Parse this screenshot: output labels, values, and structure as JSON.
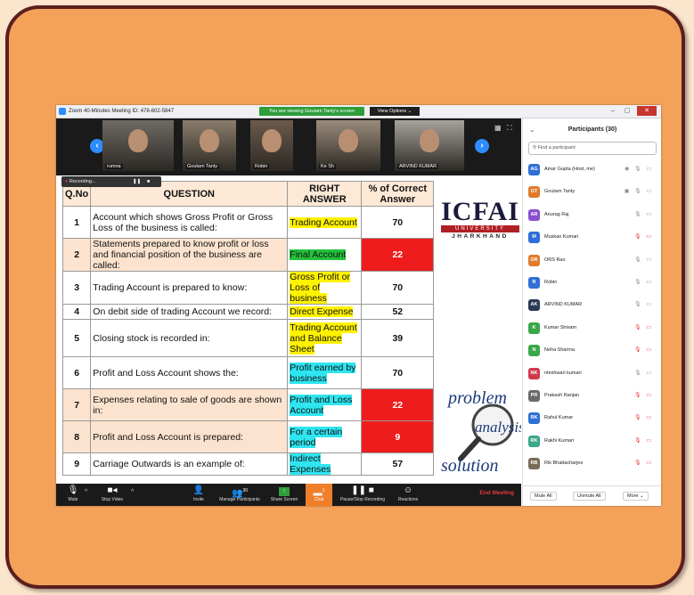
{
  "window": {
    "title": "Zoom 40-Minutes Meeting ID: 478-602-5847",
    "viewing": "You are viewing Goutam Tanty's screen",
    "view_options": "View Options ⌄"
  },
  "video_strip": {
    "tiles": [
      {
        "name": "rumna",
        "color": "#6f6a64"
      },
      {
        "name": "Goutam Tanty",
        "color": "#8a7d6c"
      },
      {
        "name": "Robin",
        "color": "#6b5a4c"
      },
      {
        "name": "Ke Sh",
        "color": "#9b8c7c"
      },
      {
        "name": "ARVIND KUMAR",
        "color": "#a6a39b"
      }
    ]
  },
  "recording": {
    "label": "Recording..."
  },
  "table": {
    "headers": {
      "no": "Q.No",
      "question": "QUESTION",
      "answer": "RIGHT ANSWER",
      "percent": "% of Correct Answer"
    },
    "rows": [
      {
        "no": "1",
        "question": "Account which shows Gross Profit or Gross Loss of the business is called:",
        "answer": "Trading Account",
        "hl": "hy",
        "percent": "70",
        "red": false,
        "shade": false
      },
      {
        "no": "2",
        "question": "Statements prepared to know profit or loss and financial position of the business are called:",
        "answer": "Final Account",
        "hl": "hg",
        "percent": "22",
        "red": true,
        "shade": true
      },
      {
        "no": "3",
        "question": "Trading Account is prepared to know:",
        "answer": "Gross Profit or Loss of business",
        "hl": "hy",
        "percent": "70",
        "red": false,
        "shade": false
      },
      {
        "no": "4",
        "question": "On debit side of trading Account we record:",
        "answer": "Direct Expense",
        "hl": "hy",
        "percent": "52",
        "red": false,
        "shade": false
      },
      {
        "no": "5",
        "question": "Closing stock is recorded in:",
        "answer": "Trading Account and Balance Sheet",
        "hl": "hy",
        "percent": "39",
        "red": false,
        "shade": false
      },
      {
        "no": "6",
        "question": "Profit and Loss Account shows the:",
        "answer": "Profit earned by business",
        "hl": "hc",
        "percent": "70",
        "red": false,
        "shade": false
      },
      {
        "no": "7",
        "question": "Expenses relating to sale of goods are shown in:",
        "answer": "Profit and Loss Account",
        "hl": "hc",
        "percent": "22",
        "red": true,
        "shade": true
      },
      {
        "no": "8",
        "question": "Profit and Loss Account is prepared:",
        "answer": "For a certain period",
        "hl": "hc",
        "percent": "9",
        "red": true,
        "shade": true
      },
      {
        "no": "9",
        "question": "Carriage Outwards is an example of:",
        "answer": "Indirect Expenses",
        "hl": "hc",
        "percent": "57",
        "red": false,
        "shade": false
      }
    ]
  },
  "logo": {
    "name": "ICFAI",
    "sub": "UNIVERSITY",
    "region": "JHARKHAND"
  },
  "graphic": {
    "word1": "problem",
    "word2": "analysis",
    "word3": "solution"
  },
  "toolbar": {
    "mute": "Mute",
    "stop_video": "Stop Video",
    "invite": "Invite",
    "manage": "Manage Participants",
    "participant_count": "30",
    "share": "Share Screen",
    "chat": "Chat",
    "chat_badge": "1",
    "record": "Pause/Stop Recording",
    "reactions": "Reactions",
    "end": "End Meeting"
  },
  "panel": {
    "title": "Participants (30)",
    "search_placeholder": "Find a participant",
    "participants": [
      {
        "initials": "AG",
        "color": "#2f6fd6",
        "name": "Amar Gupta (Host, me)",
        "icons": "◉ 🎙 ▭",
        "muted": false
      },
      {
        "initials": "GT",
        "color": "#e07a2c",
        "name": "Goutam Tanty",
        "icons": "▣ 🎙 ▭",
        "muted": false
      },
      {
        "initials": "AR",
        "color": "#8a4fd0",
        "name": "Anurag Raj",
        "icons": "🎙 ▭",
        "muted": false
      },
      {
        "initials": "M",
        "color": "#2f6fd6",
        "name": "Muskan Kumari",
        "icons": "🎙 ▭",
        "muted": true
      },
      {
        "initials": "OR",
        "color": "#e07a2c",
        "name": "ORS Rao",
        "icons": "🎙 ▭",
        "muted": false
      },
      {
        "initials": "R",
        "color": "#2f6fd6",
        "name": "Robin",
        "icons": "🎙 ▭",
        "muted": false
      },
      {
        "initials": "AK",
        "color": "#2b3a55",
        "name": "ARVIND KUMAR",
        "icons": "🎙 ▭",
        "muted": false
      },
      {
        "initials": "K",
        "color": "#3aa84b",
        "name": "Kumar Shivam",
        "icons": "🎙 ▭",
        "muted": true
      },
      {
        "initials": "N",
        "color": "#3aa84b",
        "name": "Neha Sharma",
        "icons": "🎙 ▭",
        "muted": true
      },
      {
        "initials": "NK",
        "color": "#d0394a",
        "name": "nteshwari kumari",
        "icons": "🎙 ▭",
        "muted": false
      },
      {
        "initials": "PR",
        "color": "#6a6a6a",
        "name": "Prakash Ranjan",
        "icons": "🎙 ▭",
        "muted": true
      },
      {
        "initials": "RK",
        "color": "#2f6fd6",
        "name": "Rahul Kumar",
        "icons": "🎙 ▭",
        "muted": true
      },
      {
        "initials": "RK",
        "color": "#3aa88a",
        "name": "Rakhi Kumari",
        "icons": "🎙 ▭",
        "muted": true
      },
      {
        "initials": "RB",
        "color": "#7a6a5a",
        "name": "Rik Bhattacharjee",
        "icons": "🎙 ▭",
        "muted": true
      }
    ],
    "mute_all": "Mute All",
    "unmute_all": "Unmute All",
    "more": "More ⌄"
  }
}
